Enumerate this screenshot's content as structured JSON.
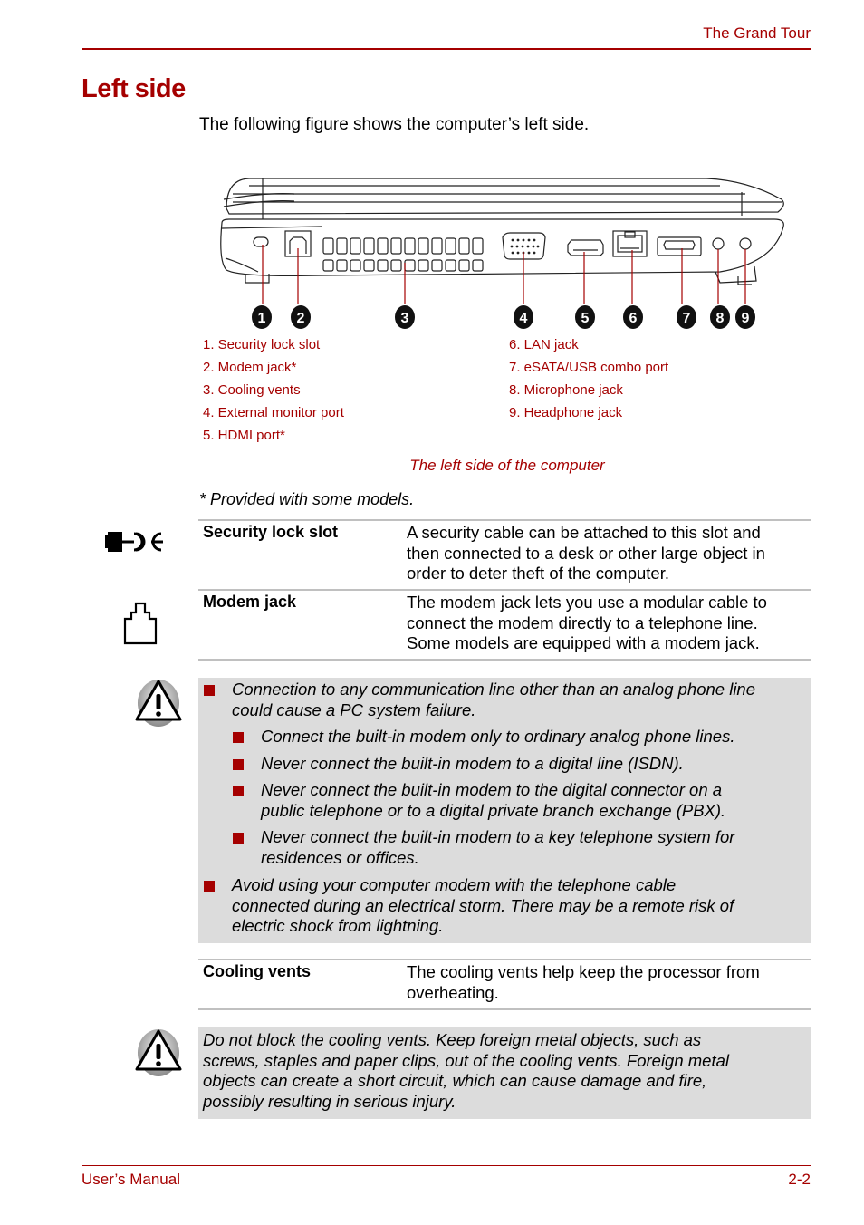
{
  "header": {
    "section_title": "The Grand Tour"
  },
  "page": {
    "title": "Left side",
    "intro": "The following figure shows the computer’s left side."
  },
  "figure": {
    "callouts": [
      "1",
      "2",
      "3",
      "4",
      "5",
      "6",
      "7",
      "8",
      "9"
    ],
    "legend": [
      "1. Security lock slot",
      "2. Modem jack*",
      "3. Cooling vents",
      "4. External monitor port",
      "5. HDMI port*",
      "6. LAN jack",
      "7. eSATA/USB combo port",
      "8. Microphone jack",
      "9. Headphone jack"
    ],
    "caption": "The left side of the computer"
  },
  "footnote": "* Provided with some models.",
  "specs": [
    {
      "icon": "security-lock-icon",
      "term": "Security lock slot",
      "lines": [
        "A security cable can be attached to this slot and",
        "then connected to a desk or other large object in",
        "order to deter theft of the computer."
      ]
    },
    {
      "icon": "modem-jack-icon",
      "term": "Modem jack",
      "lines": [
        "The modem jack lets you use a modular cable to",
        "connect the modem directly to a telephone line.",
        "Some models are equipped with a modem jack."
      ]
    }
  ],
  "modem_warning": {
    "icon": "warning-icon",
    "items": [
      {
        "level": 1,
        "lines": [
          "Connection to any communication line other than an analog phone line",
          "could cause a PC system failure."
        ]
      },
      {
        "level": 2,
        "lines": [
          "Connect the built-in modem only to ordinary analog phone lines."
        ]
      },
      {
        "level": 2,
        "lines": [
          "Never connect the built-in modem to a digital line (ISDN)."
        ]
      },
      {
        "level": 2,
        "lines": [
          "Never connect the built-in modem to the digital connector on a",
          "public telephone or to a digital private branch exchange (PBX)."
        ]
      },
      {
        "level": 2,
        "lines": [
          "Never connect the built-in modem to a key telephone system for",
          "residences or offices."
        ]
      },
      {
        "level": 1,
        "lines": [
          "Avoid using your computer modem with the telephone cable",
          "connected during an electrical storm. There may be a remote risk of",
          "electric shock from lightning."
        ]
      }
    ]
  },
  "cooling": {
    "term": "Cooling vents",
    "lines": [
      "The cooling vents help keep the processor from",
      "overheating."
    ]
  },
  "cooling_warning": {
    "icon": "warning-icon",
    "lines": [
      "Do not block the cooling vents. Keep foreign metal objects, such as",
      "screws, staples and paper clips, out of the cooling vents. Foreign metal",
      "objects can create a short circuit, which can cause damage and fire,",
      "possibly resulting in serious injury."
    ]
  },
  "footer": {
    "left": "User’s Manual",
    "right": "2-2"
  },
  "colors": {
    "accent": "#a50000",
    "note_bg": "#dcdcdc",
    "rule": "#c0c0c0"
  }
}
